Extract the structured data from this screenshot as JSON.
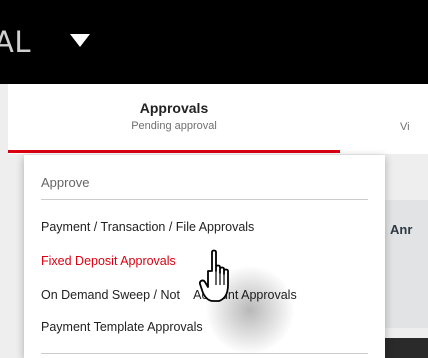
{
  "header": {
    "brand_fragment": "AL",
    "caret_icon": "caret-down-icon"
  },
  "tabs": [
    {
      "title": "Approvals",
      "subtitle": "Pending approval",
      "active": true
    },
    {
      "title": "",
      "subtitle": "Vi",
      "active": false
    }
  ],
  "menu": {
    "heading": "Approve",
    "items": [
      {
        "label": "Payment / Transaction / File Approvals",
        "active": false
      },
      {
        "label": "Fixed Deposit Approvals",
        "active": true
      },
      {
        "label": "On Demand Sweep / Not    Account Approvals",
        "active": false
      },
      {
        "label": "Payment Template Approvals",
        "active": false
      }
    ]
  },
  "right_panel": {
    "text": "Anr"
  },
  "cursor": {
    "icon": "hand-pointer-icon"
  },
  "colors": {
    "accent": "#db0011",
    "header_bg": "#000000",
    "panel_bg": "#e1e3e4"
  }
}
